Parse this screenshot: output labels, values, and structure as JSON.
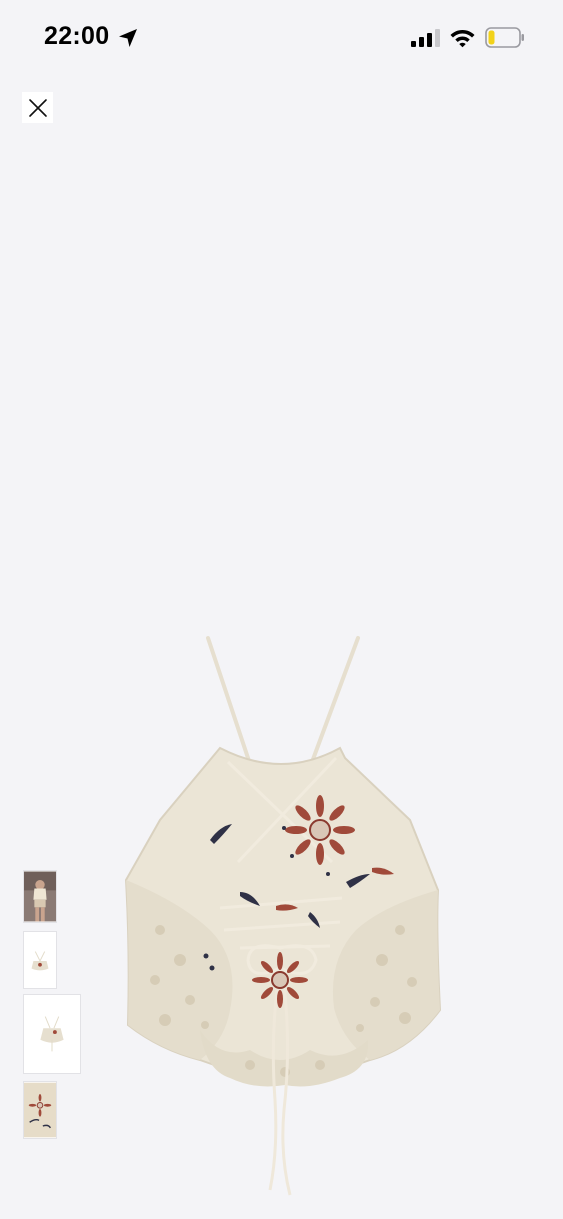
{
  "status_bar": {
    "time": "22:00",
    "icons": [
      "location-arrow-icon",
      "cellular-signal-icon",
      "wifi-icon",
      "battery-low-icon"
    ],
    "battery_color": "#f2d21a"
  },
  "toolbar": {
    "close_icon": "close-icon"
  },
  "gallery": {
    "main_image": "crochet-halter-top-back-view",
    "thumbnails": [
      {
        "name": "model-wearing-top"
      },
      {
        "name": "top-front-view"
      },
      {
        "name": "top-back-view"
      },
      {
        "name": "embroidery-detail"
      }
    ],
    "selected_index": 2
  },
  "colors": {
    "background": "#f4f4f7",
    "garment": "#e9e2d3",
    "embroidery_rust": "#a04a3a",
    "embroidery_navy": "#2f3146"
  }
}
